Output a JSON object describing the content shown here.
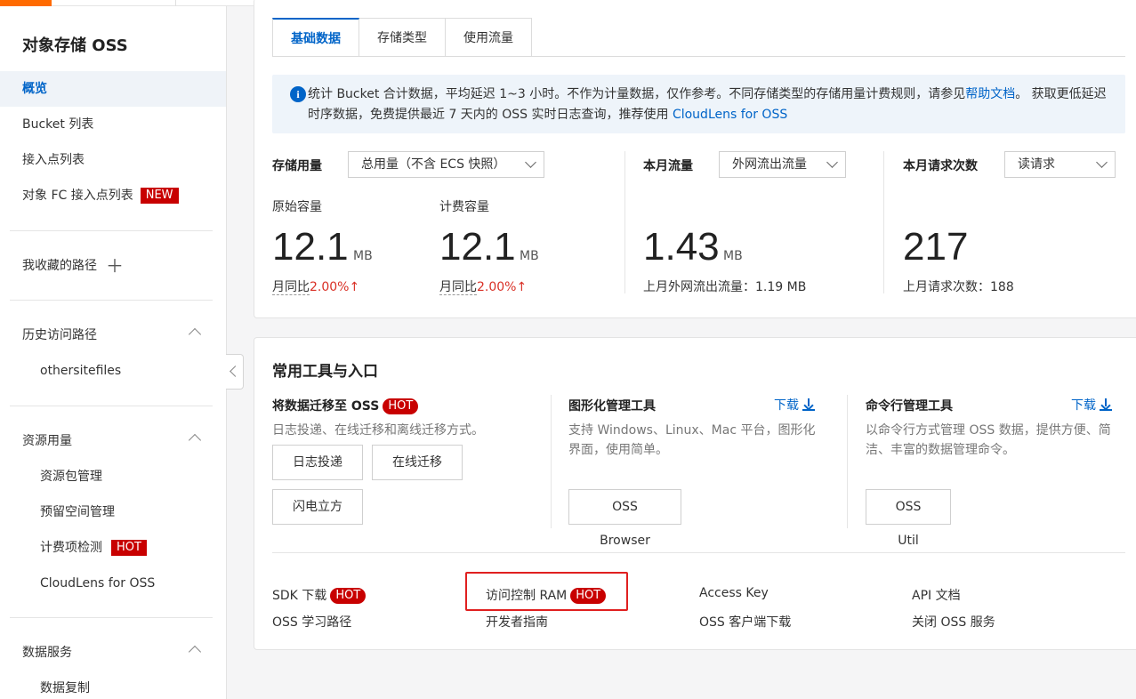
{
  "sidebar": {
    "title": "对象存储 OSS",
    "items": [
      {
        "label": "概览"
      },
      {
        "label": "Bucket 列表"
      },
      {
        "label": "接入点列表"
      },
      {
        "label": "对象 FC 接入点列表",
        "badge": "NEW"
      }
    ],
    "favorites": "我收藏的路径",
    "history": {
      "label": "历史访问路径",
      "items": [
        "othersitefiles"
      ]
    },
    "resources": {
      "label": "资源用量",
      "items": [
        "资源包管理",
        "预留空间管理",
        "计费项检测",
        "CloudLens for OSS"
      ],
      "hot_badge": "HOT"
    },
    "data_services": {
      "label": "数据服务",
      "items": [
        "数据复制"
      ]
    }
  },
  "tabs": [
    "基础数据",
    "存储类型",
    "使用流量"
  ],
  "notice": {
    "text1": "统计 Bucket 合计数据，平均延迟 1~3 小时。不作为计量数据，仅作参考。不同存储类型的存储用量计费规则，请参见",
    "link1": "帮助文档",
    "text2": "。 获取更低延迟时序数据，免费提供最近 7 天内的 OSS 实时日志查询，推荐使用 ",
    "link2": "CloudLens for OSS"
  },
  "storage": {
    "label": "存储用量",
    "select": "总用量（不含 ECS 快照）",
    "raw": {
      "label": "原始容量",
      "value": "12.1",
      "unit": "MB",
      "yoy_label": "月同比",
      "yoy_value": "2.00%"
    },
    "billed": {
      "label": "计费容量",
      "value": "12.1",
      "unit": "MB",
      "yoy_label": "月同比",
      "yoy_value": "2.00%"
    }
  },
  "traffic": {
    "label": "本月流量",
    "select": "外网流出流量",
    "value": "1.43",
    "unit": "MB",
    "prev": "上月外网流出流量：1.19 MB"
  },
  "requests": {
    "label": "本月请求次数",
    "select": "读请求",
    "value": "217",
    "prev": "上月请求次数：188"
  },
  "tools": {
    "title": "常用工具与入口",
    "migrate": {
      "title": "将数据迁移至 OSS",
      "badge": "HOT",
      "desc": "日志投递、在线迁移和离线迁移方式。",
      "buttons": [
        "日志投递",
        "在线迁移",
        "闪电立方"
      ]
    },
    "gui": {
      "title": "图形化管理工具",
      "download": "下载",
      "desc1": "支持 Windows、Linux、Mac 平台，图形化",
      "desc2": "界面，使用简单。",
      "button": "OSS Browser"
    },
    "cli": {
      "title": "命令行管理工具",
      "download": "下载",
      "desc1": "以命令行方式管理 OSS 数据，提供方便、简",
      "desc2": "洁、丰富的数据管理命令。",
      "button": "OSS Util"
    }
  },
  "quick_links": {
    "sdk": "SDK 下载",
    "ram": "访问控制 RAM",
    "hot": "HOT",
    "access_key": "Access Key",
    "api": "API 文档",
    "learning": "OSS 学习路径",
    "dev_guide": "开发者指南",
    "client": "OSS 客户端下载",
    "close": "关闭 OSS 服务"
  },
  "colors": {
    "accent": "#0064c8",
    "hot": "#c80000",
    "up": "#d93026",
    "highlight": "#e02020",
    "brand": "#ff6a00"
  }
}
